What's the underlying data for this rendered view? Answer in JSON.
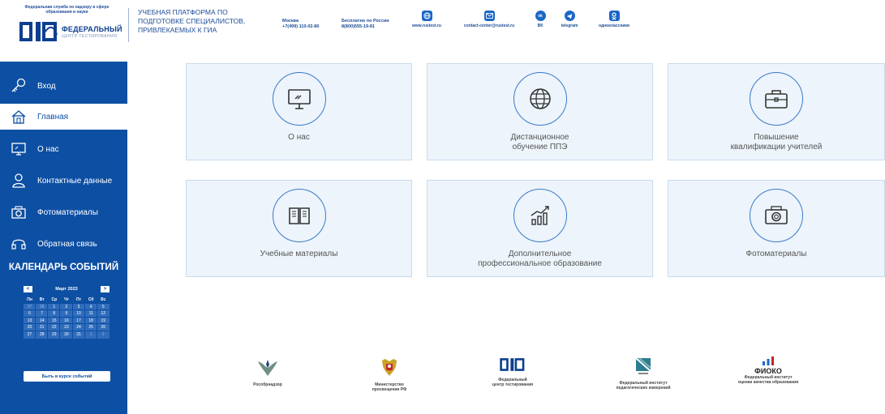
{
  "header": {
    "org_line": "Федеральная служба по надзору в сфере образования и науки",
    "logo_big": "ФЕДЕРАЛЬНЫЙ",
    "logo_small": "ЦЕНТР ТЕСТИРОВАНИЯ",
    "platform_title": "УЧЕБНАЯ ПЛАТФОРМА ПО ПОДГОТОВКЕ СПЕЦИАЛИСТОВ, ПРИВЛЕКАЕМЫХ К ГИА",
    "moscow_label": "Москва",
    "moscow_phone": "+7(499) 110-02-80",
    "free_label": "Бесплатно по России",
    "free_phone": "8(800)555-19-81",
    "social": [
      {
        "icon": "globe-icon",
        "label": "www.rustest.ru"
      },
      {
        "icon": "mail-icon",
        "label": "contact-center@rustest.ru"
      },
      {
        "icon": "vk-icon",
        "label": "ВК"
      },
      {
        "icon": "telegram-icon",
        "label": "telegram"
      },
      {
        "icon": "odnoklassniki-icon",
        "label": "одноклассники"
      }
    ]
  },
  "sidebar": {
    "items": [
      {
        "icon": "key-icon",
        "label": "Вход"
      },
      {
        "icon": "home-icon",
        "label": "Главная",
        "active": true
      },
      {
        "icon": "monitor-icon",
        "label": "О нас"
      },
      {
        "icon": "contact-icon",
        "label": "Контактные данные"
      },
      {
        "icon": "camera-icon",
        "label": "Фотоматериалы"
      },
      {
        "icon": "headset-icon",
        "label": "Обратная связь"
      }
    ],
    "calendar": {
      "title": "КАЛЕНДАРЬ СОБЫТИЙ",
      "month": "Март 2023",
      "prev": "<",
      "next": ">",
      "dow": [
        "Пн",
        "Вт",
        "Ср",
        "Чт",
        "Пт",
        "Сб",
        "Вс"
      ],
      "weeks": [
        [
          "27",
          "28",
          "1",
          "2",
          "3",
          "4",
          "5"
        ],
        [
          "6",
          "7",
          "8",
          "9",
          "10",
          "11",
          "12"
        ],
        [
          "13",
          "14",
          "15",
          "16",
          "17",
          "18",
          "19"
        ],
        [
          "20",
          "21",
          "22",
          "23",
          "24",
          "25",
          "26"
        ],
        [
          "27",
          "28",
          "29",
          "30",
          "31",
          "1",
          "2"
        ]
      ],
      "subscribe": "Быть в курсе событий"
    }
  },
  "tiles": [
    {
      "icon": "monitor-icon",
      "line1": "О нас",
      "line2": ""
    },
    {
      "icon": "globe-icon",
      "line1": "Дистанционное",
      "line2": "обучение ППЭ"
    },
    {
      "icon": "briefcase-icon",
      "line1": "Повышение",
      "line2": "квалификации учителей"
    },
    {
      "icon": "book-icon",
      "line1": "Учебные материалы",
      "line2": ""
    },
    {
      "icon": "growth-chart-icon",
      "line1": "Дополнительное",
      "line2": "профессиональное образование"
    },
    {
      "icon": "camera-icon",
      "line1": "Фотоматериалы",
      "line2": ""
    }
  ],
  "footer": [
    {
      "icon": "rosobrnadzor-emblem",
      "line1": "Рособрнадзор",
      "line2": ""
    },
    {
      "icon": "coat-of-arms-emblem",
      "line1": "Министерство",
      "line2": "просвещения РФ"
    },
    {
      "icon": "ftc-logo",
      "line1": "Федеральный",
      "line2": "центр тестирования"
    },
    {
      "icon": "fipi-logo",
      "line1": "Федеральный институт",
      "line2": "педагогических измерений"
    },
    {
      "icon": "fioko-logo",
      "brand": "ФИОКО",
      "line1": "Федеральный институт",
      "line2": "оценки качества образования"
    }
  ],
  "colors": {
    "brand_blue": "#0d4fa3",
    "tile_bg": "#edf4fb",
    "accent": "#1a67c7"
  }
}
